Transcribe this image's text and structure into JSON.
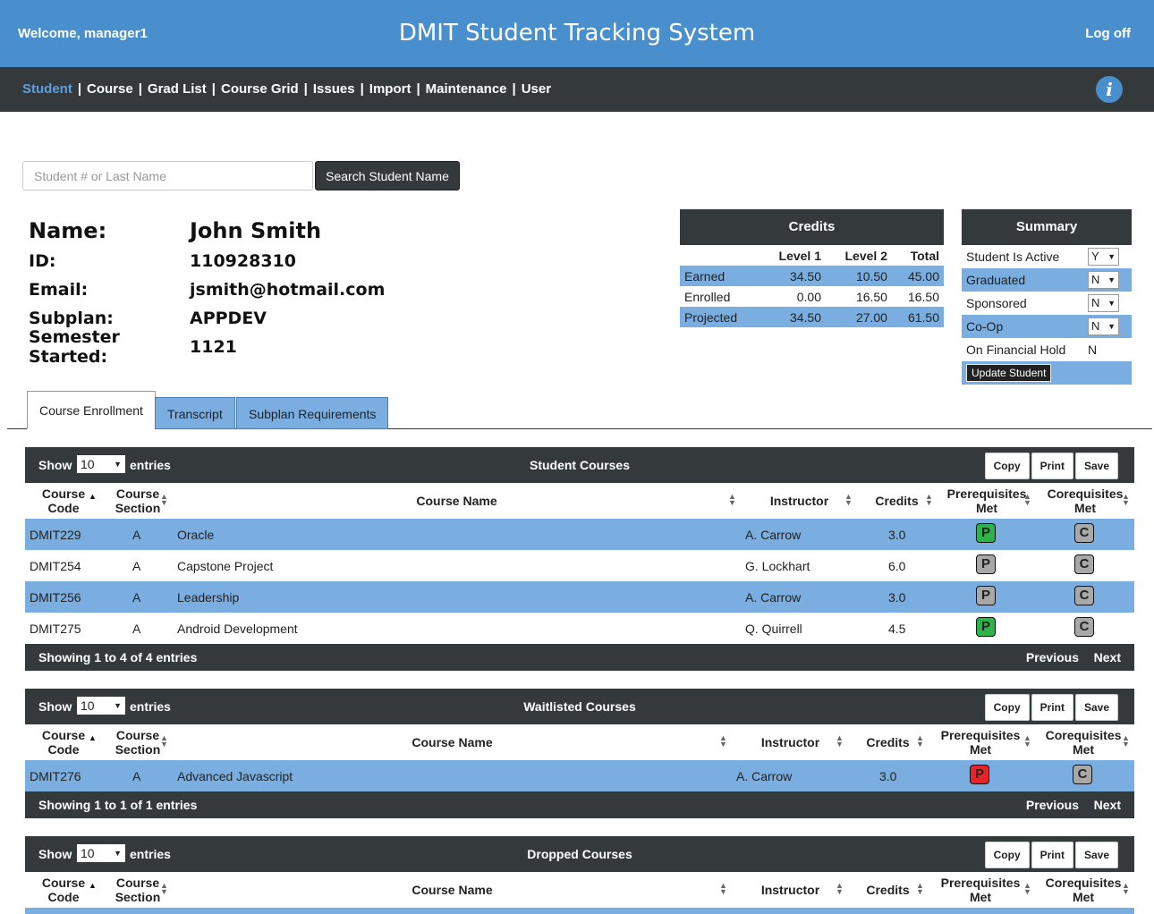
{
  "header": {
    "welcome": "Welcome, manager1",
    "title": "DMIT Student Tracking System",
    "logoff": "Log off"
  },
  "nav": {
    "items": [
      "Student",
      "Course",
      "Grad List",
      "Course Grid",
      "Issues",
      "Import",
      "Maintenance",
      "User"
    ],
    "separator": "|",
    "info_icon": "i"
  },
  "search": {
    "placeholder": "Student # or Last Name",
    "button": "Search Student Name"
  },
  "student": {
    "name_label": "Name:",
    "name": "John Smith",
    "id_label": "ID:",
    "id": "110928310",
    "email_label": "Email:",
    "email": "jsmith@hotmail.com",
    "subplan_label": "Subplan:",
    "subplan": "APPDEV",
    "semester_label": "Semester Started:",
    "semester": "1121"
  },
  "credits": {
    "title": "Credits",
    "headers": [
      "",
      "Level 1",
      "Level 2",
      "Total"
    ],
    "rows": [
      [
        "Earned",
        "34.50",
        "10.50",
        "45.00"
      ],
      [
        "Enrolled",
        "0.00",
        "16.50",
        "16.50"
      ],
      [
        "Projected",
        "34.50",
        "27.00",
        "61.50"
      ]
    ]
  },
  "summary": {
    "title": "Summary",
    "active_label": "Student Is Active",
    "active": "Y",
    "graduated_label": "Graduated",
    "graduated": "N",
    "sponsored_label": "Sponsored",
    "sponsored": "N",
    "coop_label": "Co-Op",
    "coop": "N",
    "hold_label": "On Financial Hold",
    "hold": "N",
    "update_button": "Update Student"
  },
  "tabs": [
    "Course Enrollment",
    "Transcript",
    "Subplan Requirements"
  ],
  "table_common": {
    "show": "Show",
    "length": "10",
    "entries": "entries",
    "copy": "Copy",
    "print": "Print",
    "save": "Save",
    "previous": "Previous",
    "next": "Next",
    "col_code_1": "Course",
    "col_code_2": "Code",
    "col_section_1": "Course",
    "col_section_2": "Section",
    "col_name": "Course Name",
    "col_instructor": "Instructor",
    "col_credits": "Credits",
    "col_prereq_1": "Prerequisites",
    "col_prereq_2": "Met",
    "col_coreq_1": "Corequisites",
    "col_coreq_2": "Met",
    "prereq_letter": "P",
    "coreq_letter": "C"
  },
  "student_courses": {
    "title": "Student Courses",
    "rows": [
      {
        "code": "DMIT229",
        "section": "A",
        "name": "Oracle",
        "instructor": "A. Carrow",
        "credits": "3.0",
        "prereq": "green",
        "coreq": "gray"
      },
      {
        "code": "DMIT254",
        "section": "A",
        "name": "Capstone Project",
        "instructor": "G. Lockhart",
        "credits": "6.0",
        "prereq": "gray",
        "coreq": "gray"
      },
      {
        "code": "DMIT256",
        "section": "A",
        "name": "Leadership",
        "instructor": "A. Carrow",
        "credits": "3.0",
        "prereq": "gray",
        "coreq": "gray"
      },
      {
        "code": "DMIT275",
        "section": "A",
        "name": "Android Development",
        "instructor": "Q. Quirrell",
        "credits": "4.5",
        "prereq": "green",
        "coreq": "gray"
      }
    ],
    "showing": "Showing 1 to 4 of 4 entries"
  },
  "waitlisted_courses": {
    "title": "Waitlisted Courses",
    "rows": [
      {
        "code": "DMIT276",
        "section": "A",
        "name": "Advanced Javascript",
        "instructor": "A. Carrow",
        "credits": "3.0",
        "prereq": "red",
        "coreq": "gray"
      }
    ],
    "showing": "Showing 1 to 1 of 1 entries"
  },
  "dropped_courses": {
    "title": "Dropped Courses"
  },
  "colors": {
    "header_blue": "#4a8fcd",
    "nav_dark": "#343a3c",
    "row_blue": "#7aaee0",
    "met_green": "#2db34a",
    "unmet_red": "#e8232a",
    "neutral_gray": "#a8a8a8"
  }
}
